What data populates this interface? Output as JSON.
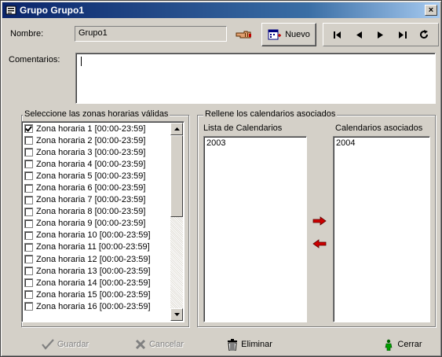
{
  "window": {
    "title": "Grupo Grupo1",
    "close_label": "×"
  },
  "header": {
    "name_label": "Nombre:",
    "name_value": "Grupo1",
    "new_label": "Nuevo",
    "comments_label": "Comentarios:",
    "comments_value": ""
  },
  "zones": {
    "title": "Seleccione las zonas horarias válidas",
    "items": [
      {
        "label": "Zona horaria 1 [00:00-23:59]",
        "checked": true
      },
      {
        "label": "Zona horaria 2 [00:00-23:59]",
        "checked": false
      },
      {
        "label": "Zona horaria 3 [00:00-23:59]",
        "checked": false
      },
      {
        "label": "Zona horaria 4 [00:00-23:59]",
        "checked": false
      },
      {
        "label": "Zona horaria 5 [00:00-23:59]",
        "checked": false
      },
      {
        "label": "Zona horaria 6 [00:00-23:59]",
        "checked": false
      },
      {
        "label": "Zona horaria 7 [00:00-23:59]",
        "checked": false
      },
      {
        "label": "Zona horaria 8 [00:00-23:59]",
        "checked": false
      },
      {
        "label": "Zona horaria 9 [00:00-23:59]",
        "checked": false
      },
      {
        "label": "Zona horaria 10 [00:00-23:59]",
        "checked": false
      },
      {
        "label": "Zona horaria 11 [00:00-23:59]",
        "checked": false
      },
      {
        "label": "Zona horaria 12 [00:00-23:59]",
        "checked": false
      },
      {
        "label": "Zona horaria 13 [00:00-23:59]",
        "checked": false
      },
      {
        "label": "Zona horaria 14 [00:00-23:59]",
        "checked": false
      },
      {
        "label": "Zona horaria 15 [00:00-23:59]",
        "checked": false
      },
      {
        "label": "Zona horaria 16 [00:00-23:59]",
        "checked": false
      }
    ]
  },
  "calendars": {
    "title": "Rellene los calendarios asociados",
    "list_title": "Lista de Calendarios",
    "list_items": [
      "2003"
    ],
    "assoc_title": "Calendarios asociados",
    "assoc_items": [
      "2004"
    ]
  },
  "footer": {
    "save_label": "Guardar",
    "cancel_label": "Cancelar",
    "delete_label": "Eliminar",
    "close_label": "Cerrar"
  },
  "colors": {
    "title_bar": "#0a246a",
    "arrow": "#cc0000",
    "face": "#d4d0c8"
  }
}
